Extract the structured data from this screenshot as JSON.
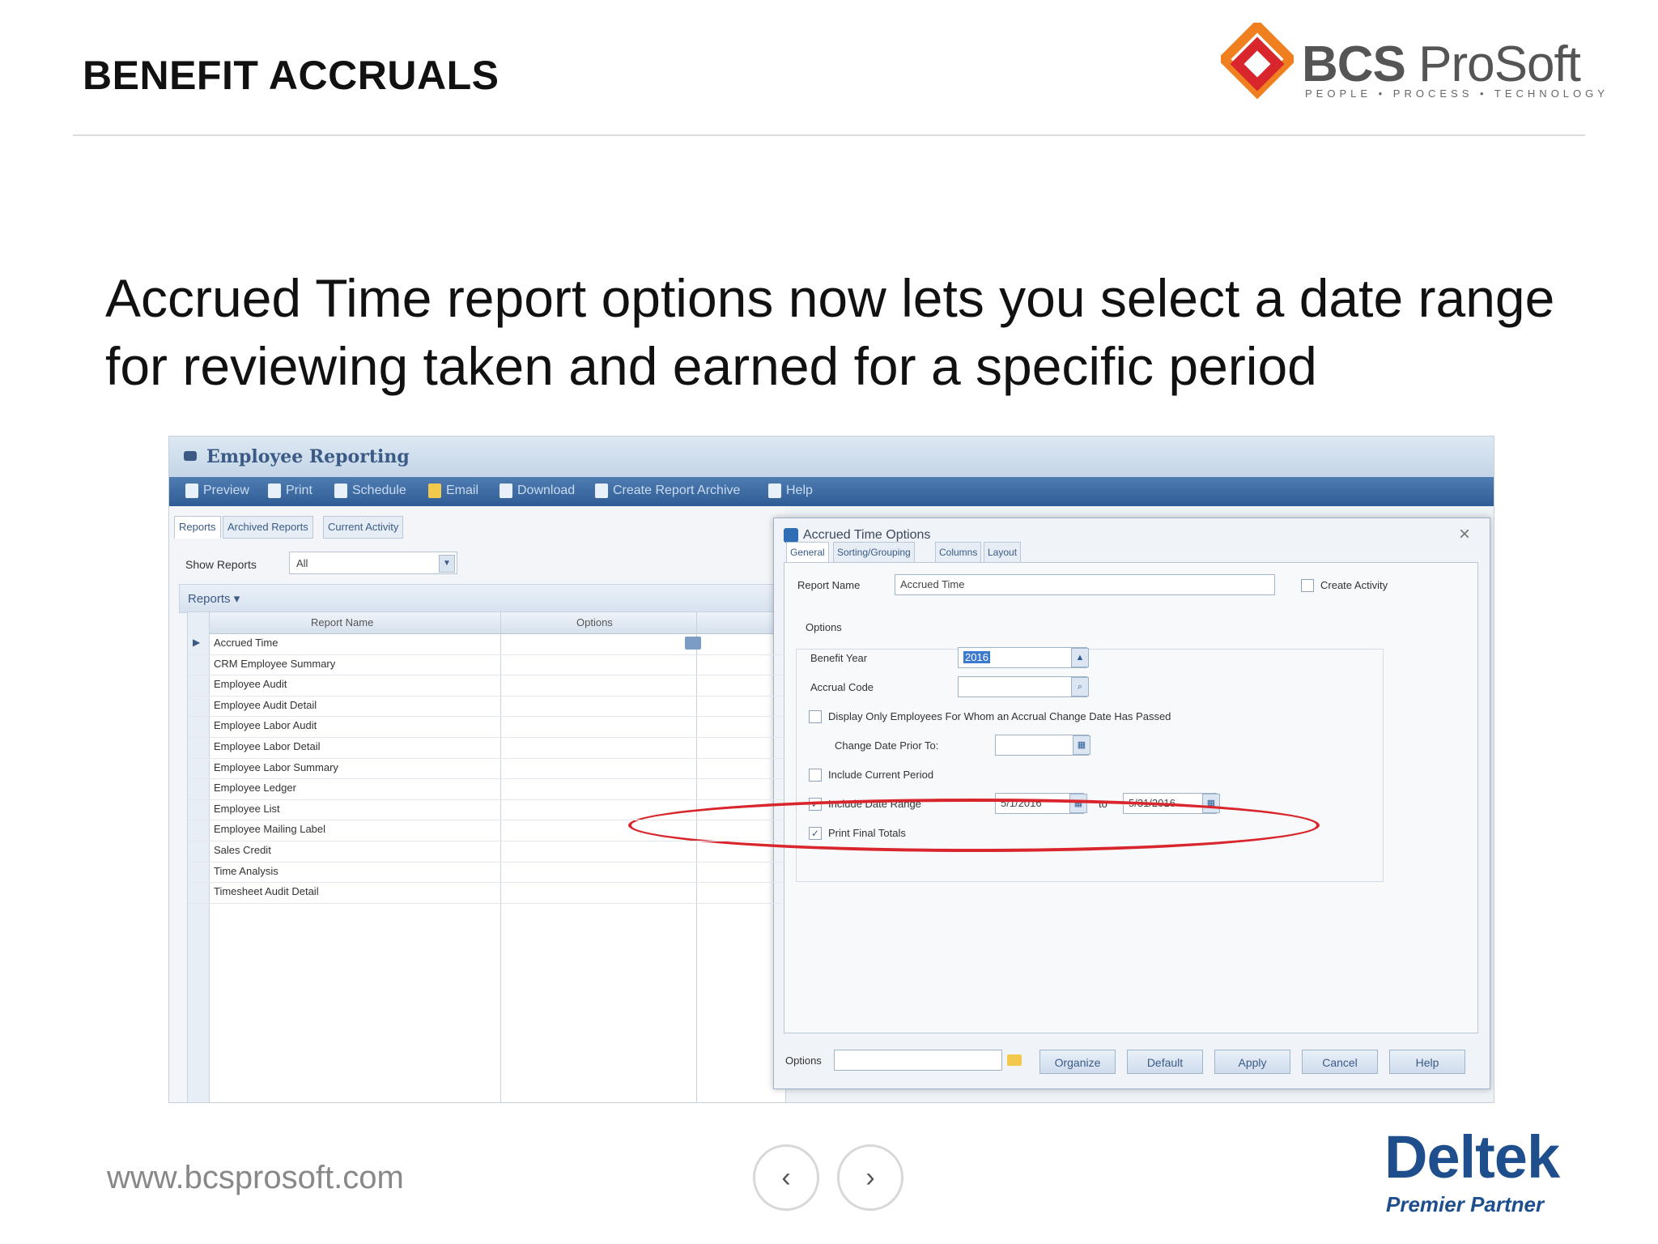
{
  "slide": {
    "title": "BENEFIT ACCRUALS",
    "headline": "Accrued Time report options now lets you select a date range for reviewing taken and earned for a specific period",
    "url": "www.bcsprosoft.com"
  },
  "logo": {
    "name_bold": "BCS",
    "name": "ProSoft",
    "tagline": "PEOPLE • PROCESS • TECHNOLOGY"
  },
  "partner": {
    "name": "Deltek",
    "tagline": "Premier Partner"
  },
  "nav": {
    "prev": "‹",
    "next": "›"
  },
  "app": {
    "title": "Employee Reporting",
    "toolbar": [
      "Preview",
      "Print",
      "Schedule",
      "Email",
      "Download",
      "Create Report Archive",
      "Help"
    ],
    "tabs": [
      "Reports",
      "Archived Reports",
      "Current Activity"
    ],
    "show_reports_label": "Show Reports",
    "show_reports_value": "All",
    "reports_bar_label": "Reports",
    "columns": [
      "Report Name",
      "Options"
    ],
    "reports": [
      "Accrued Time",
      "CRM Employee Summary",
      "Employee Audit",
      "Employee Audit Detail",
      "Employee Labor Audit",
      "Employee Labor Detail",
      "Employee Labor Summary",
      "Employee Ledger",
      "Employee List",
      "Employee Mailing Label",
      "Sales Credit",
      "Time Analysis",
      "Timesheet Audit Detail"
    ]
  },
  "dialog": {
    "title": "Accrued Time Options",
    "close": "×",
    "tabs": [
      "General",
      "Sorting/Grouping",
      "Columns",
      "Layout"
    ],
    "report_name_label": "Report Name",
    "report_name_value": "Accrued Time",
    "create_activity_label": "Create Activity",
    "options_label": "Options",
    "benefit_year_label": "Benefit Year",
    "benefit_year_value": "2016",
    "accrual_code_label": "Accrual Code",
    "display_only_label": "Display Only Employees For Whom an Accrual Change Date Has Passed",
    "change_date_label": "Change Date Prior To:",
    "include_current_label": "Include Current Period",
    "include_range_label": "Include Date Range",
    "range_from": "5/1/2016",
    "range_to_label": "to",
    "range_to": "5/31/2016",
    "print_totals_label": "Print Final Totals",
    "options_footer_label": "Options",
    "buttons": [
      "Organize",
      "Default",
      "Apply",
      "Cancel",
      "Help"
    ]
  }
}
